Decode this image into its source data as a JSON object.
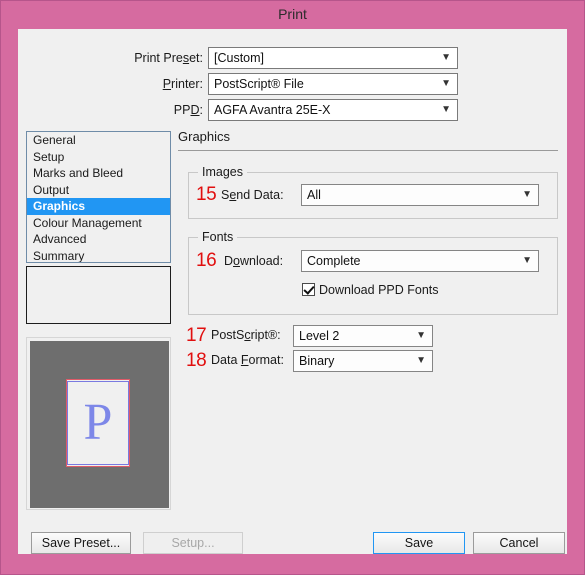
{
  "window": {
    "title": "Print",
    "frame_color": "#d66ba0",
    "client_bg": "#f0f0f0"
  },
  "top_fields": [
    {
      "label_pre": "Print Pre",
      "label_acc": "s",
      "label_post": "et:",
      "value": "[Custom]",
      "arrow": "chevron-down-icon"
    },
    {
      "label_pre": "",
      "label_acc": "P",
      "label_post": "rinter:",
      "value": "PostScript® File",
      "arrow": "chevron-down-icon"
    },
    {
      "label_pre": "PP",
      "label_acc": "D",
      "label_post": ":",
      "value": "AGFA Avantra 25E-X",
      "arrow": "chevron-down-icon"
    }
  ],
  "sidebar": {
    "selected": "Graphics",
    "selected_color": "#2196f3",
    "items": [
      {
        "label": "General"
      },
      {
        "label": "Setup"
      },
      {
        "label": "Marks and Bleed"
      },
      {
        "label": "Output"
      },
      {
        "label": "Graphics"
      },
      {
        "label": "Colour Management"
      },
      {
        "label": "Advanced"
      },
      {
        "label": "Summary"
      }
    ],
    "description_text": ""
  },
  "preview": {
    "page_letter": "P",
    "canvas_color": "#6e6e6e",
    "page_color": "#f0f0f0",
    "page_border_color": "#e05a68",
    "page_inner_border_color": "#7a7ae0",
    "letter_color": "#7d87e8"
  },
  "pane": {
    "title": "Graphics",
    "images_group": {
      "legend": "Images",
      "number": "15",
      "label_pre": "S",
      "label_acc": "e",
      "label_post": "nd Data:",
      "value": "All"
    },
    "fonts_group": {
      "legend": "Fonts",
      "number": "16",
      "label_pre": "D",
      "label_acc": "o",
      "label_post": "wnload:",
      "value": "Complete",
      "checkbox_label": "Download PPD Fonts",
      "checkbox_checked": true
    },
    "postscript_row": {
      "number": "17",
      "label_pre": "PostS",
      "label_acc": "c",
      "label_post": "ript®:",
      "value": "Level 2"
    },
    "dataformat_row": {
      "number": "18",
      "label_pre": "Data ",
      "label_acc": "F",
      "label_post": "ormat:",
      "value": "Binary"
    }
  },
  "footer": {
    "save_preset": "Save Preset...",
    "setup": "Setup...",
    "save": "Save",
    "cancel": "Cancel",
    "setup_disabled": true,
    "save_is_default": true
  },
  "annotation_color": "#e10f0f"
}
